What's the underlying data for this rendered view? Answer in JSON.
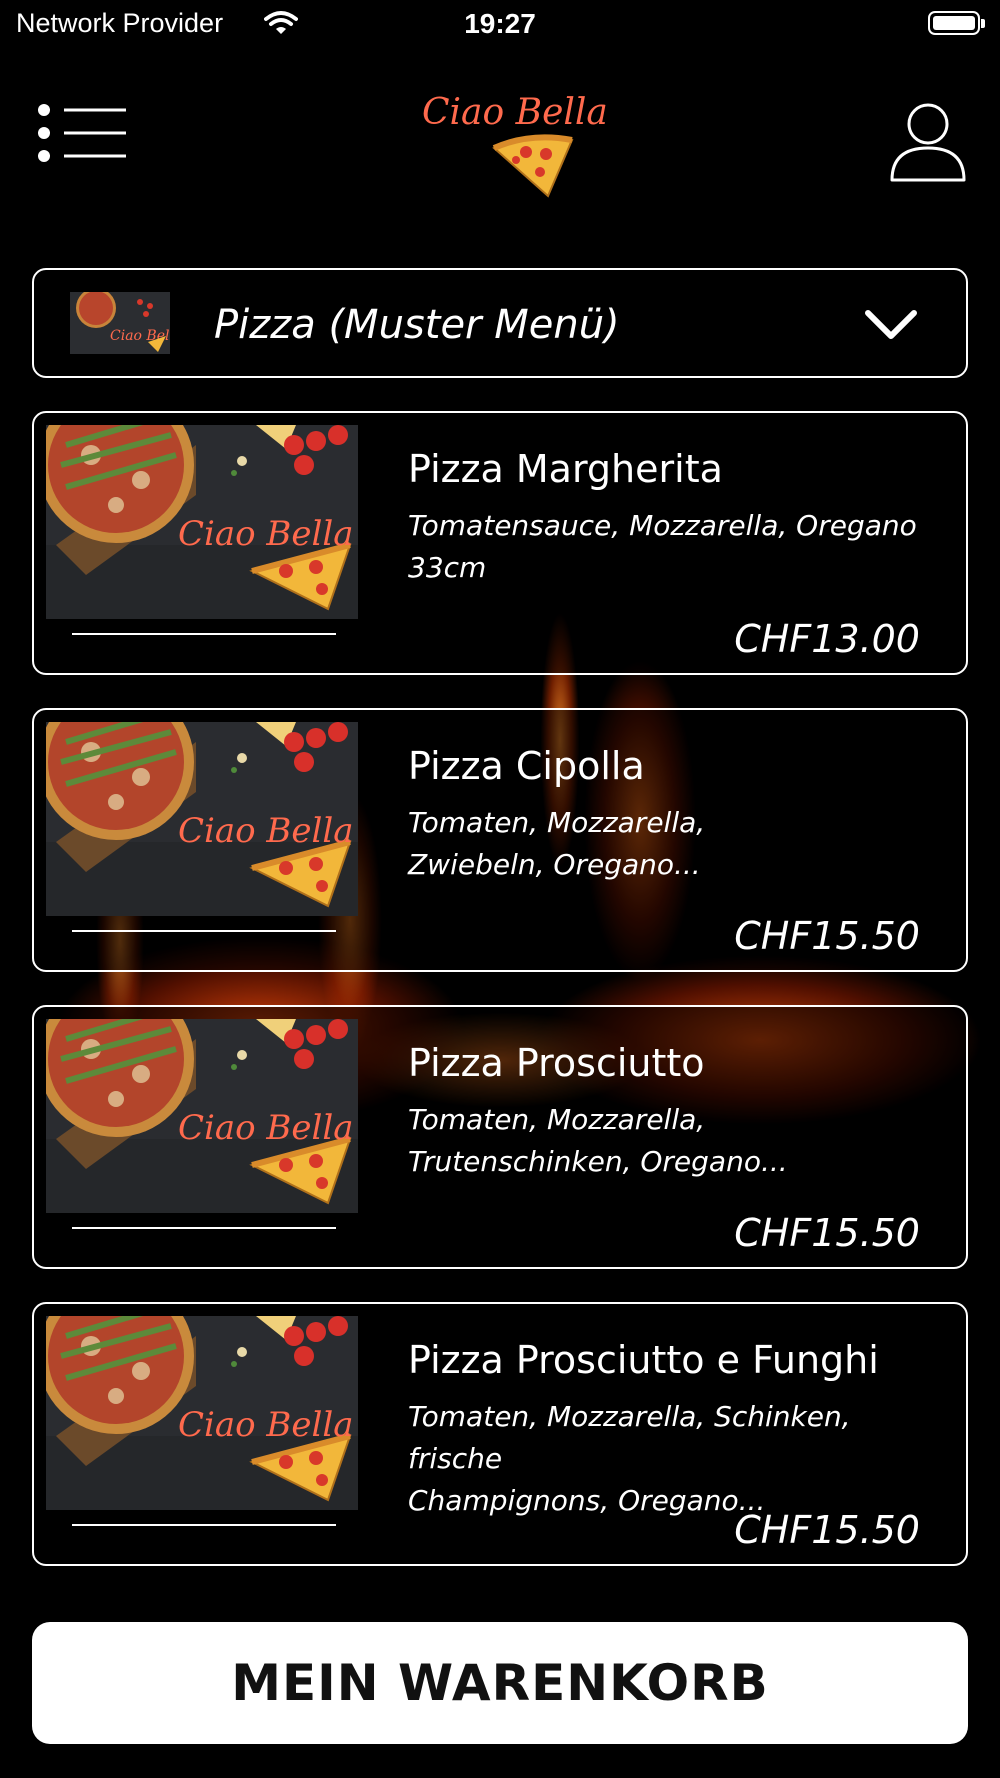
{
  "status_bar": {
    "carrier": "Network Provider",
    "time": "19:27"
  },
  "header": {
    "brand": "Ciao Bella"
  },
  "category": {
    "label": "Pizza (Muster Menü)",
    "thumb_text": "Ciao Bella"
  },
  "products": [
    {
      "name": "Pizza Margherita",
      "desc_line1": "Tomatensauce, Mozzarella, Oregano",
      "desc_line2": "33cm",
      "price": "CHF13.00",
      "image_text": "Ciao Bella"
    },
    {
      "name": "Pizza Cipolla",
      "desc_line1": "Tomaten, Mozzarella,",
      "desc_line2": "Zwiebeln, Oregano...",
      "price": "CHF15.50",
      "image_text": "Ciao Bella"
    },
    {
      "name": "Pizza Prosciutto",
      "desc_line1": "Tomaten, Mozzarella,",
      "desc_line2": "Trutenschinken, Oregano...",
      "price": "CHF15.50",
      "image_text": "Ciao Bella"
    },
    {
      "name": "Pizza Prosciutto e Funghi",
      "desc_line1": "Tomaten, Mozzarella, Schinken, frische",
      "desc_line2": "Champignons, Oregano...",
      "price": "CHF15.50",
      "image_text": "Ciao Bella"
    }
  ],
  "cart": {
    "label": "MEIN WARENKORB"
  },
  "colors": {
    "background": "#000000",
    "brand": "#ff6a4d",
    "accent_cheese": "#f2b73a",
    "button_bg": "#ffffff"
  },
  "icons": [
    "wifi-icon",
    "battery-icon",
    "menu-list-icon",
    "pizza-slice-icon",
    "user-icon",
    "chevron-down-icon"
  ]
}
